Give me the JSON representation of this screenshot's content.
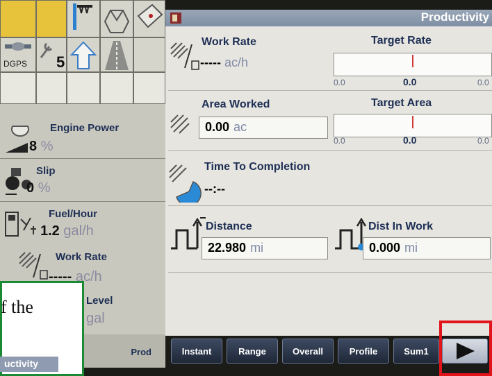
{
  "left": {
    "dgps_label": "DGPS",
    "satellite_count": "5",
    "items": [
      {
        "label": "Engine Power",
        "value": "8",
        "unit": "%"
      },
      {
        "label": "Slip",
        "value": "0",
        "unit": "%"
      },
      {
        "label": "Fuel/Hour",
        "value": "1.2",
        "unit": "gal/h"
      },
      {
        "label": "Work Rate",
        "value": "-----",
        "unit": "ac/h"
      },
      {
        "label": "Level",
        "unit": "gal"
      }
    ],
    "active_tab": "Prod"
  },
  "main": {
    "title": "Productivity",
    "work_rate": {
      "label": "Work Rate",
      "value": "-----",
      "unit": "ac/h"
    },
    "target_rate": {
      "label": "Target Rate",
      "min": "0.0",
      "center": "0.0",
      "max": "0.0",
      "level": 0.5
    },
    "area_worked": {
      "label": "Area Worked",
      "value": "0.00",
      "unit": "ac"
    },
    "target_area": {
      "label": "Target Area",
      "min": "0.0",
      "center": "0.0",
      "max": "0.0",
      "level": 0.5
    },
    "time_to_completion": {
      "label": "Time To Completion",
      "value": "--:--"
    },
    "distance": {
      "label": "Distance",
      "value": "22.980",
      "unit": "mi"
    },
    "dist_in_work": {
      "label": "Dist In Work",
      "value": "0.000",
      "unit": "mi"
    }
  },
  "tabs": [
    "Instant",
    "Range",
    "Overall",
    "Profile",
    "Sum1"
  ],
  "callout": {
    "text": "f the",
    "snippet": "uctivity"
  },
  "colors": {
    "accent_yellow": "#e6c33a",
    "highlight_red": "#e1141b",
    "callout_green": "#1c8a34"
  }
}
